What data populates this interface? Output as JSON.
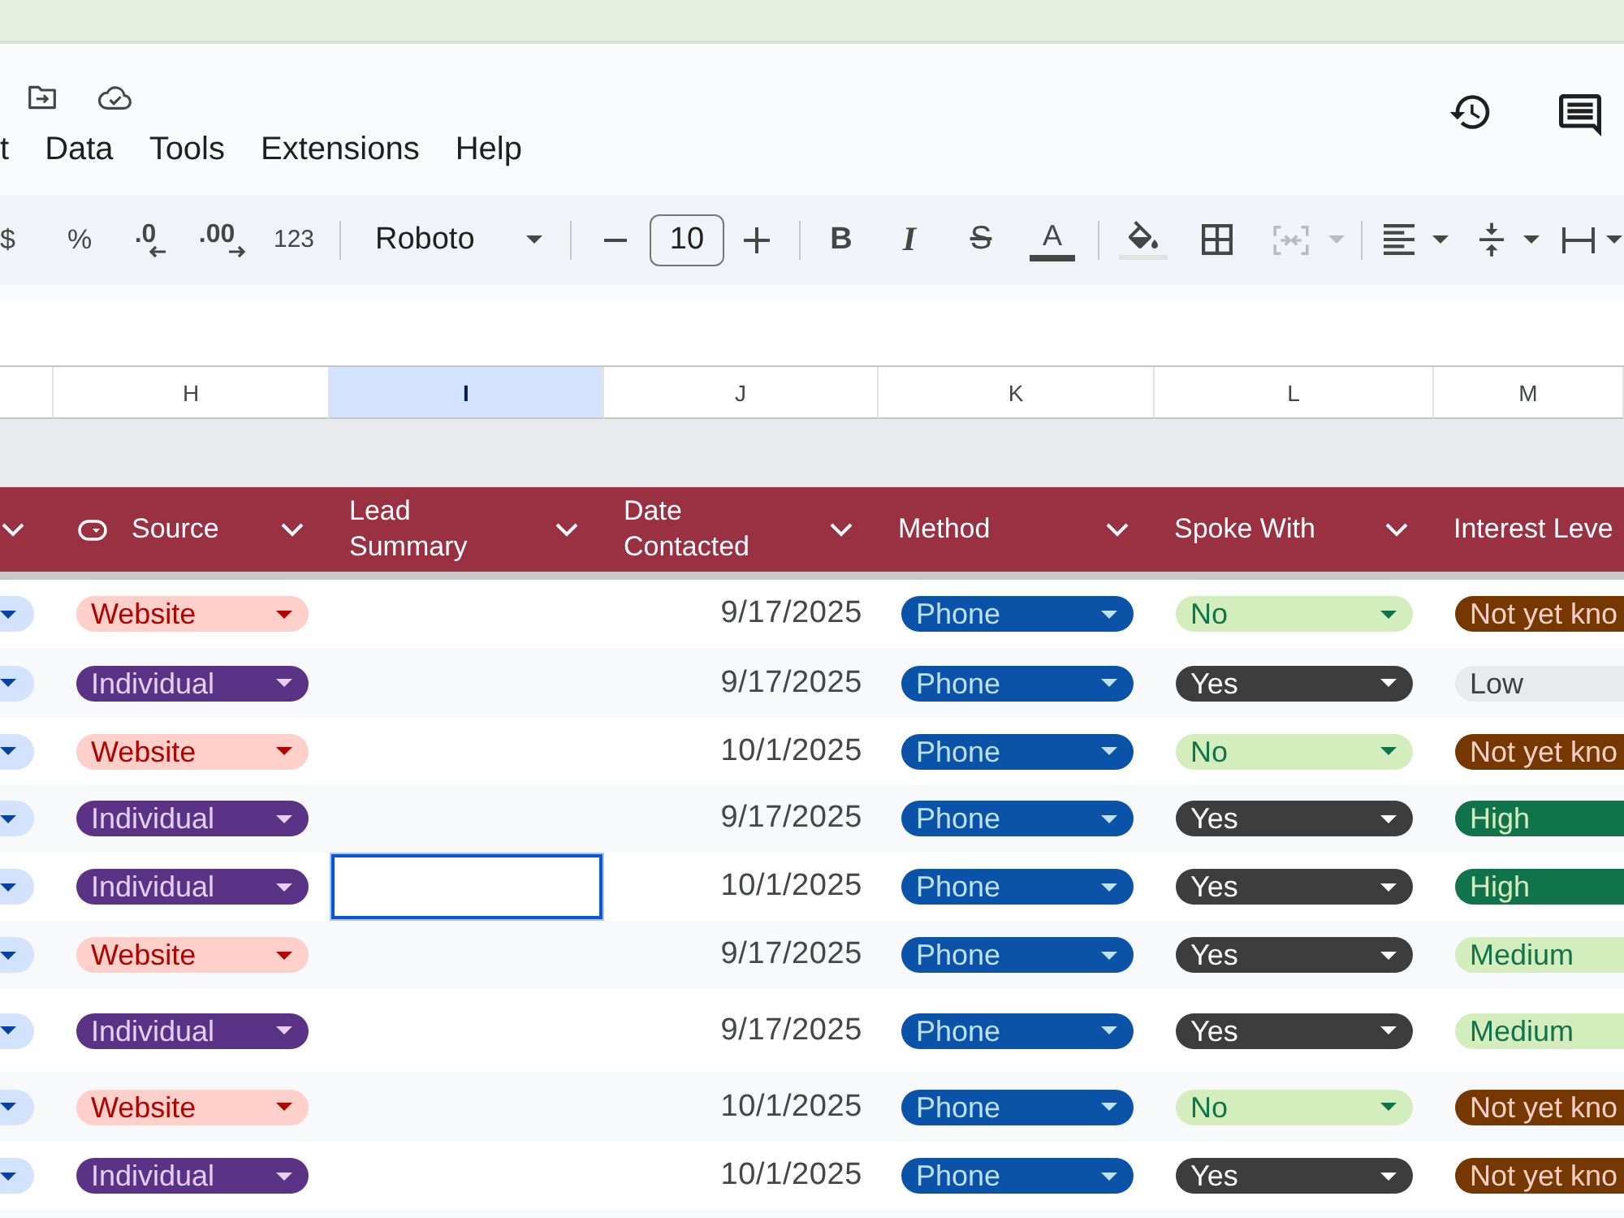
{
  "menu": [
    "t",
    "Data",
    "Tools",
    "Extensions",
    "Help"
  ],
  "toolbar": [
    {
      "kind": "text",
      "label": "$"
    },
    {
      "kind": "text",
      "label": "%"
    },
    {
      "kind": "decrease",
      "label": ".0"
    },
    {
      "kind": "increase",
      "label": ".00"
    },
    {
      "kind": "text",
      "label": "123"
    },
    {
      "kind": "separator"
    },
    {
      "kind": "font",
      "value": "Roboto"
    },
    {
      "kind": "separator"
    },
    {
      "kind": "size",
      "value": "10"
    },
    {
      "kind": "separator"
    },
    {
      "kind": "bold",
      "label": "B"
    },
    {
      "kind": "italic",
      "label": "I"
    },
    {
      "kind": "strike",
      "label": "S"
    },
    {
      "kind": "color",
      "label": "A"
    },
    {
      "kind": "separator"
    },
    {
      "kind": "fill",
      "disabled": false
    },
    {
      "kind": "borders",
      "disabled": false
    },
    {
      "kind": "merge",
      "disabled": true
    },
    {
      "kind": "separator"
    },
    {
      "kind": "halign",
      "disabled": false
    },
    {
      "kind": "valign",
      "disabled": false
    },
    {
      "kind": "wrap",
      "disabled": false
    }
  ],
  "column_letters": [
    {
      "label": "H",
      "selected": false
    },
    {
      "label": "I",
      "selected": true
    },
    {
      "label": "J",
      "selected": false
    },
    {
      "label": "K",
      "selected": false
    },
    {
      "label": "L",
      "selected": false
    },
    {
      "label": "M",
      "selected": false
    }
  ],
  "table": {
    "columns": [
      {
        "label": "Source",
        "type_icon": true,
        "filter_arrow": true
      },
      {
        "label": "Lead Summary",
        "type_icon": false,
        "filter_arrow": true
      },
      {
        "label": "Date Contacted",
        "type_icon": false,
        "filter_arrow": true
      },
      {
        "label": "Method",
        "type_icon": false,
        "filter_arrow": true
      },
      {
        "label": "Spoke With",
        "type_icon": false,
        "filter_arrow": true
      },
      {
        "label": "Interest Leve",
        "type_icon": false,
        "filter_arrow": false
      }
    ],
    "rows": [
      {
        "source": {
          "label": "Website",
          "color": "#ffcfc9"
        },
        "lead_summary": {
          "selected": false
        },
        "date_contacted": "9/17/2025",
        "method": {
          "label": "Phone",
          "color": "#0a53a8"
        },
        "spoke_with": {
          "label": "No",
          "color": "#d4edbc"
        },
        "interest_level": {
          "label": "Not yet kno",
          "color": "#753800"
        }
      },
      {
        "source": {
          "label": "Individual",
          "color": "#5a3286"
        },
        "lead_summary": {
          "selected": false
        },
        "date_contacted": "9/17/2025",
        "method": {
          "label": "Phone",
          "color": "#0a53a8"
        },
        "spoke_with": {
          "label": "Yes",
          "color": "#3d3d3d"
        },
        "interest_level": {
          "label": "Low",
          "color": "#e8eaed"
        }
      },
      {
        "source": {
          "label": "Website",
          "color": "#ffcfc9"
        },
        "lead_summary": {
          "selected": false
        },
        "date_contacted": "10/1/2025",
        "method": {
          "label": "Phone",
          "color": "#0a53a8"
        },
        "spoke_with": {
          "label": "No",
          "color": "#d4edbc"
        },
        "interest_level": {
          "label": "Not yet kno",
          "color": "#753800"
        }
      },
      {
        "source": {
          "label": "Individual",
          "color": "#5a3286"
        },
        "lead_summary": {
          "selected": false
        },
        "date_contacted": "9/17/2025",
        "method": {
          "label": "Phone",
          "color": "#0a53a8"
        },
        "spoke_with": {
          "label": "Yes",
          "color": "#3d3d3d"
        },
        "interest_level": {
          "label": "High",
          "color": "#11734b"
        }
      },
      {
        "source": {
          "label": "Individual",
          "color": "#5a3286"
        },
        "lead_summary": {
          "selected": true
        },
        "date_contacted": "10/1/2025",
        "method": {
          "label": "Phone",
          "color": "#0a53a8"
        },
        "spoke_with": {
          "label": "Yes",
          "color": "#3d3d3d"
        },
        "interest_level": {
          "label": "High",
          "color": "#11734b"
        }
      },
      {
        "source": {
          "label": "Website",
          "color": "#ffcfc9"
        },
        "lead_summary": {
          "selected": false
        },
        "date_contacted": "9/17/2025",
        "method": {
          "label": "Phone",
          "color": "#0a53a8"
        },
        "spoke_with": {
          "label": "Yes",
          "color": "#3d3d3d"
        },
        "interest_level": {
          "label": "Medium",
          "color": "#d4edbc"
        }
      },
      {
        "source": {
          "label": "Individual",
          "color": "#5a3286"
        },
        "lead_summary": {
          "selected": false
        },
        "date_contacted": "9/17/2025",
        "method": {
          "label": "Phone",
          "color": "#0a53a8"
        },
        "spoke_with": {
          "label": "Yes",
          "color": "#3d3d3d"
        },
        "interest_level": {
          "label": "Medium",
          "color": "#d4edbc"
        }
      },
      {
        "source": {
          "label": "Website",
          "color": "#ffcfc9"
        },
        "lead_summary": {
          "selected": false
        },
        "date_contacted": "10/1/2025",
        "method": {
          "label": "Phone",
          "color": "#0a53a8"
        },
        "spoke_with": {
          "label": "No",
          "color": "#d4edbc"
        },
        "interest_level": {
          "label": "Not yet kno",
          "color": "#753800"
        }
      },
      {
        "source": {
          "label": "Individual",
          "color": "#5a3286"
        },
        "lead_summary": {
          "selected": false
        },
        "date_contacted": "10/1/2025",
        "method": {
          "label": "Phone",
          "color": "#0a53a8"
        },
        "spoke_with": {
          "label": "Yes",
          "color": "#3d3d3d"
        },
        "interest_level": {
          "label": "Not yet kno",
          "color": "#753800"
        }
      }
    ]
  }
}
